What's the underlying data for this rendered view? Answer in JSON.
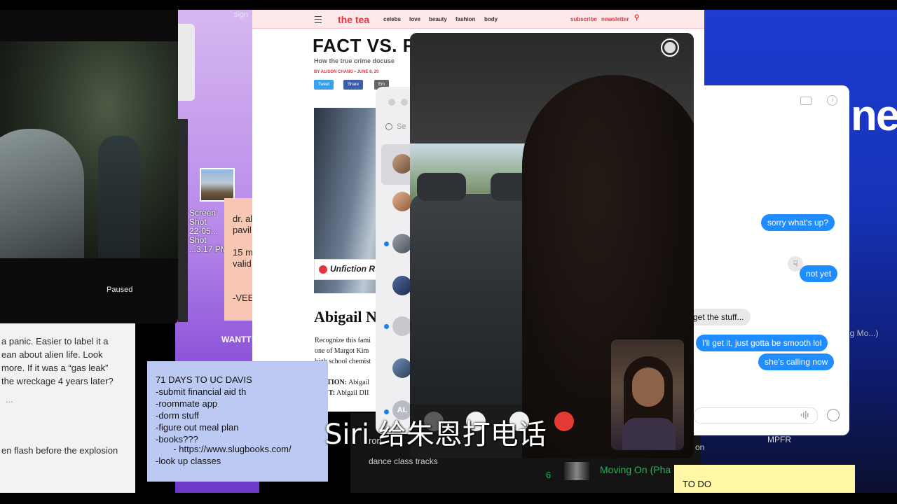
{
  "desktop": {
    "wallpaper_text_top": "sign",
    "screenshot_label": "Screen Shot\n22-05...\nShot\n...3.17 PM",
    "wallpaper_text_wantt": "WANTT",
    "right_big_text": "ne",
    "right_side_text": "ig Mo...)"
  },
  "video_player": {
    "status": "Paused"
  },
  "notes_left": {
    "lines": [
      "a panic. Easier to label it a",
      "ean about alien life. Look",
      "more. If it was a “gas leak”",
      "the wreckage 4 years later?",
      "...",
      "",
      "",
      "en flash before the explosion"
    ]
  },
  "sticky_purple": {
    "lines": [
      "71 DAYS TO UC DAVIS",
      "-submit financial aid th",
      "-roommate app",
      "-dorm stuff",
      "-figure out meal plan",
      "-books???",
      "       - https://www.slugbooks.com/",
      "-look up classes"
    ]
  },
  "sticky_peach": {
    "lines": [
      "dr. al",
      "pavil",
      "",
      "15 m",
      "valid",
      "",
      "",
      "-VEE"
    ]
  },
  "browser": {
    "logo": "the tea",
    "nav_items": [
      "celebs",
      "love",
      "beauty",
      "fashion",
      "body"
    ],
    "subscribe": "subscribe",
    "newsletter": "newsletter",
    "headline": "FACT VS. F",
    "subheadline": "How the true crime docuse",
    "byline": "BY ALISON CHANG • JUNE 8, 20",
    "share_buttons": [
      "Tweet",
      "Share",
      "Em"
    ],
    "image_caption_brand": "Unfiction R",
    "article_heading": "Abigail N",
    "body_lines": [
      "Recognize this fami",
      "one of Margot Kim",
      "high school chemist"
    ],
    "fiction_label": "FICTION:",
    "fiction_text": "Abigail",
    "fact_label": "FACT:",
    "fact_text": "Abigail DII"
  },
  "messages_sidebar": {
    "search_placeholder": "Se",
    "last_avatar_initials": "AL"
  },
  "conversation": {
    "bubbles": [
      {
        "text": "sorry what's up?",
        "from": "me"
      },
      {
        "text": "not yet",
        "from": "me"
      },
      {
        "text": "get the stuff...",
        "from": "them"
      },
      {
        "text": "I'll get it, just gotta be smooth lol",
        "from": "me"
      },
      {
        "text": "she's calling now",
        "from": "me"
      }
    ]
  },
  "subtitle": "Siri 给朱恩打电话",
  "music": {
    "dance_text": "dance class tracks",
    "row_text": "ron",
    "track_number": "6",
    "track_title": "Moving On (Pha",
    "pon": "on",
    "mpfr": "MPFR"
  },
  "sticky_yellow": {
    "title": "TO DO"
  },
  "colors": {
    "imessage_blue": "#1f8cff",
    "tea_red": "#e2363e",
    "spotify_green": "#1db954"
  }
}
